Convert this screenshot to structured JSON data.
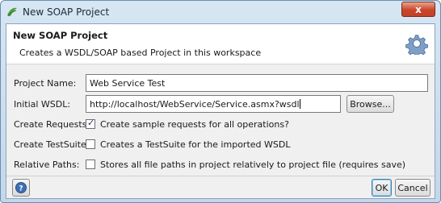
{
  "window": {
    "title": "New SOAP Project",
    "close_label": "x",
    "icon": "soapui-icon"
  },
  "header": {
    "title": "New SOAP Project",
    "description": "Creates a WSDL/SOAP based Project in this workspace",
    "icon": "gear-icon"
  },
  "form": {
    "project_name": {
      "label": "Project Name:",
      "value": "Web Service Test"
    },
    "initial_wsdl": {
      "label": "Initial WSDL:",
      "value": "http://localhost/WebService/Service.asmx?wsdl",
      "browse_label": "Browse..."
    },
    "create_requests": {
      "label": "Create Requests:",
      "checked": true,
      "text": "Create sample requests for all operations?"
    },
    "create_testsuite": {
      "label": "Create TestSuite:",
      "checked": false,
      "text": "Creates a TestSuite for the imported WSDL"
    },
    "relative_paths": {
      "label": "Relative Paths:",
      "checked": false,
      "text": "Stores all file paths in project relatively to project file (requires save)"
    }
  },
  "footer": {
    "help_icon": "help-icon",
    "ok_label": "OK",
    "cancel_label": "Cancel"
  }
}
